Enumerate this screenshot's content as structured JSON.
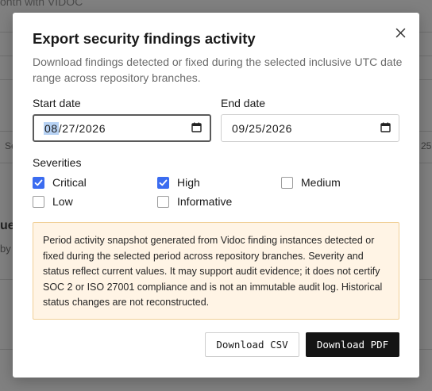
{
  "background": {
    "top_fragment": "onth with VIDOC",
    "left_col_fragment": "Se",
    "right_col_fragment": "25",
    "heading_fragment": "ues",
    "sub_fragment": "by"
  },
  "dialog": {
    "title": "Export security findings activity",
    "description": "Download findings detected or fixed during the selected inclusive UTC date range across repository branches.",
    "close_icon": "close-icon",
    "start_date": {
      "label": "Start date",
      "month": "08",
      "rest": "/27/2026",
      "value": "08/27/2026",
      "icon": "calendar-icon"
    },
    "end_date": {
      "label": "End date",
      "value": "09/25/2026",
      "icon": "calendar-icon"
    },
    "severities": {
      "label": "Severities",
      "options": [
        {
          "label": "Critical",
          "checked": true
        },
        {
          "label": "High",
          "checked": true
        },
        {
          "label": "Medium",
          "checked": false
        },
        {
          "label": "Low",
          "checked": false
        },
        {
          "label": "Informative",
          "checked": false
        }
      ]
    },
    "notice": "Period activity snapshot generated from Vidoc finding instances detected or fixed during the selected period across repository branches. Severity and status reflect current values. It may support audit evidence; it does not certify SOC 2 or ISO 27001 compliance and is not an immutable audit log. Historical status changes are not reconstructed.",
    "buttons": {
      "csv": "Download CSV",
      "pdf": "Download PDF"
    }
  },
  "colors": {
    "accent": "#3b6cf0",
    "notice_bg": "#fff4e5",
    "notice_border": "#f0cf97",
    "primary_button": "#141414",
    "overlay": "#808080"
  }
}
